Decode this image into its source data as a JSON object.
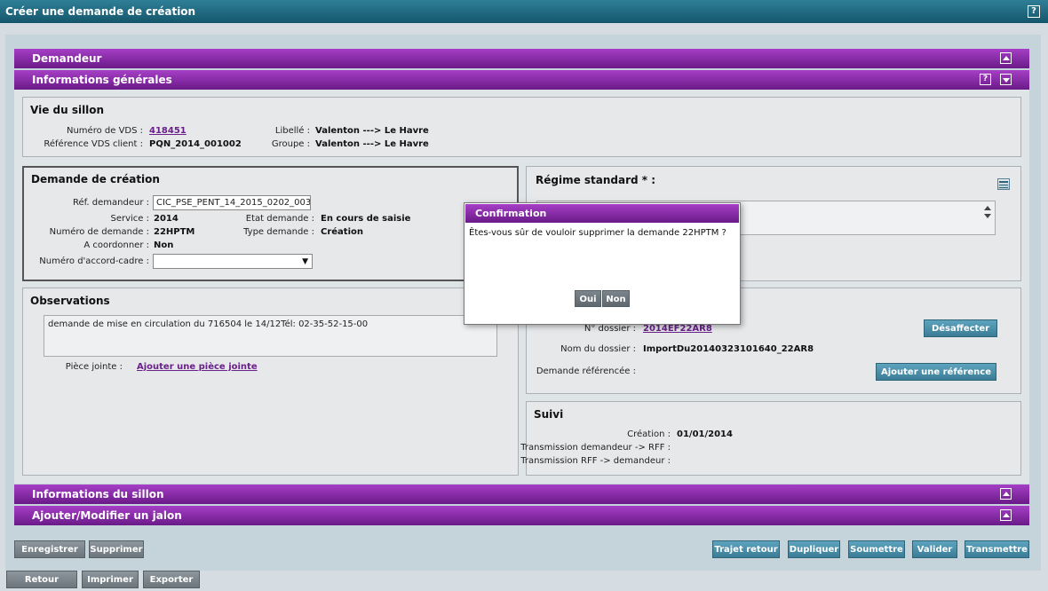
{
  "window": {
    "title": "Créer une demande de création",
    "help": "?"
  },
  "panels": {
    "demandeur": "Demandeur",
    "infos_generales": "Informations générales",
    "infos_sillon": "Informations du sillon",
    "jalon": "Ajouter/Modifier un jalon",
    "help": "?"
  },
  "vie_sillon": {
    "title": "Vie du sillon",
    "num_vds_label": "Numéro de VDS :",
    "num_vds_value": "418451",
    "ref_vds_label": "Référence VDS client :",
    "ref_vds_value": "PQN_2014_001002",
    "libelle_label": "Libellé :",
    "libelle_value": "Valenton ---> Le Havre",
    "groupe_label": "Groupe :",
    "groupe_value": "Valenton ---> Le Havre"
  },
  "demande": {
    "title": "Demande de création",
    "ref_label": "Réf. demandeur :",
    "ref_value": "CIC_PSE_PENT_14_2015_0202_003",
    "service_label": "Service :",
    "service_value": "2014",
    "num_label": "Numéro de demande :",
    "num_value": "22HPTM",
    "coord_label": "A coordonner :",
    "coord_value": "Non",
    "accord_label": "Numéro d'accord-cadre :",
    "accord_value": "",
    "etat_label": "Etat demande :",
    "etat_value": "En cours de saisie",
    "type_label": "Type demande :",
    "type_value": "Création"
  },
  "regime": {
    "title": "Régime standard * :"
  },
  "observations": {
    "title": "Observations",
    "text": "demande de mise en circulation du 716504 le 14/12Tél: 02-35-52-15-00",
    "piece_label": "Pièce jointe :",
    "piece_link": "Ajouter une pièce jointe"
  },
  "dossier": {
    "num_label": "N° dossier :",
    "num_value": "2014EF22AR8",
    "nom_label": "Nom du dossier :",
    "nom_value": "ImportDu20140323101640_22AR8",
    "ref_label": "Demande référencée :",
    "desaffecter": "Désaffecter",
    "ajouter_ref": "Ajouter une référence"
  },
  "suivi": {
    "title": "Suivi",
    "creation_label": "Création :",
    "creation_value": "01/01/2014",
    "trans1_label": "Transmission demandeur -> RFF :",
    "trans2_label": "Transmission RFF -> demandeur :"
  },
  "modal": {
    "title": "Confirmation",
    "message": "Êtes-vous sûr de vouloir supprimer la demande 22HPTM ?",
    "yes": "Oui",
    "no": "Non"
  },
  "actions": {
    "enregistrer": "Enregistrer",
    "supprimer": "Supprimer",
    "trajet_retour": "Trajet retour",
    "dupliquer": "Dupliquer",
    "soumettre": "Soumettre",
    "valider": "Valider",
    "transmettre": "Transmettre",
    "retour": "Retour",
    "imprimer": "Imprimer",
    "exporter": "Exporter"
  },
  "colors": {
    "purple": "#7b2a9b",
    "teal_title": "#1f6a80",
    "button_teal": "#4a8ea8"
  }
}
